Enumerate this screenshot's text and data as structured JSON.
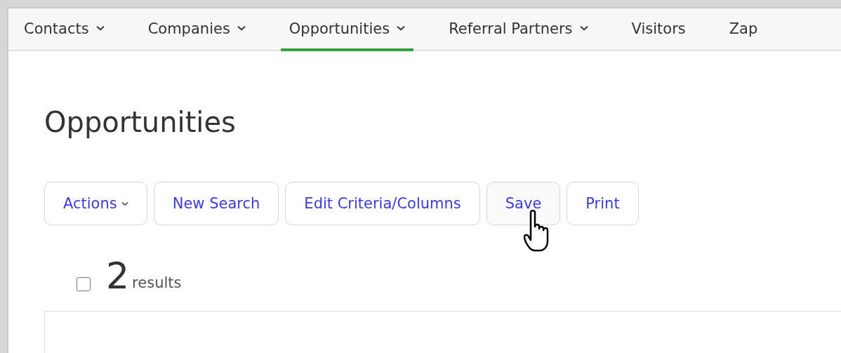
{
  "nav_tabs": [
    {
      "label": "Contacts",
      "has_menu": true,
      "selected": false
    },
    {
      "label": "Companies",
      "has_menu": true,
      "selected": false
    },
    {
      "label": "Opportunities",
      "has_menu": true,
      "selected": true
    },
    {
      "label": "Referral Partners",
      "has_menu": true,
      "selected": false
    },
    {
      "label": "Visitors",
      "has_menu": false,
      "selected": false
    },
    {
      "label": "Zap",
      "has_menu": false,
      "selected": false
    }
  ],
  "page_title": "Opportunities",
  "toolbar": [
    {
      "label": "Actions",
      "has_menu": true,
      "hovered": false
    },
    {
      "label": "New Search",
      "has_menu": false,
      "hovered": false
    },
    {
      "label": "Edit Criteria/Columns",
      "has_menu": false,
      "hovered": false
    },
    {
      "label": "Save",
      "has_menu": false,
      "hovered": true
    },
    {
      "label": "Print",
      "has_menu": false,
      "hovered": false
    }
  ],
  "results": {
    "checked": false,
    "count": "2",
    "label": "results"
  }
}
